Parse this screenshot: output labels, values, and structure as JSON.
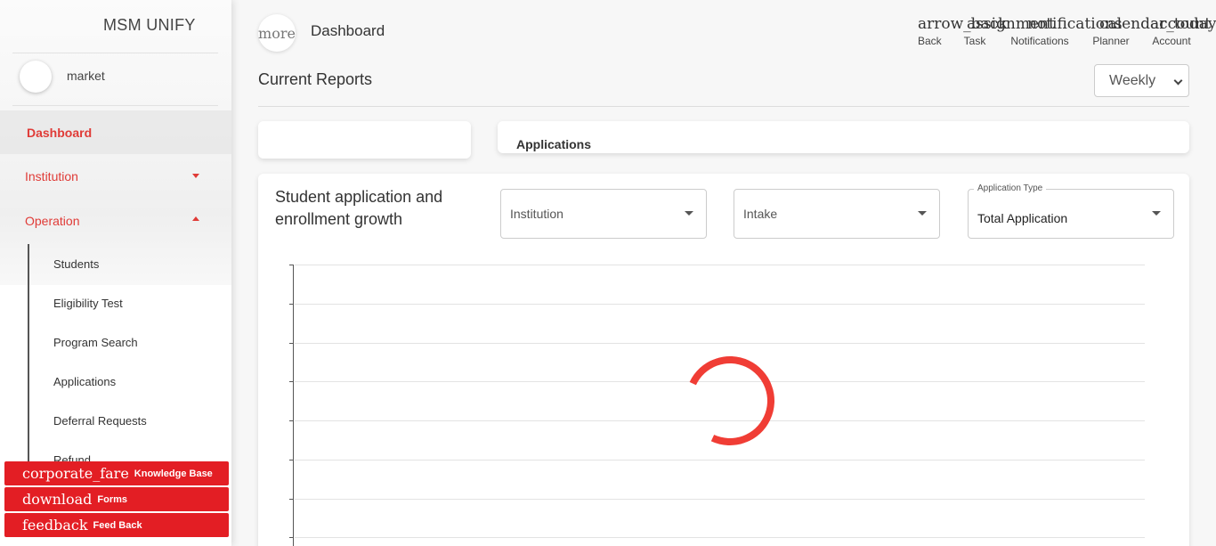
{
  "sidebar": {
    "brand": "MSM UNIFY",
    "user": {
      "name": "market"
    },
    "nav": {
      "dashboard": "Dashboard",
      "institution": "Institution",
      "operation": "Operation"
    },
    "operation_items": [
      "Students",
      "Eligibility Test",
      "Program Search",
      "Applications",
      "Deferral Requests",
      "Refund"
    ],
    "quick_links": [
      {
        "icon": "corporate_fare",
        "label": "Knowledge Base"
      },
      {
        "icon": "download",
        "label": "Forms"
      },
      {
        "icon": "feedback",
        "label": "Feed Back"
      }
    ]
  },
  "header": {
    "more_icon": "more",
    "title": "Dashboard",
    "actions": [
      {
        "icon": "arrow_back",
        "label": "Back"
      },
      {
        "icon": "assignment",
        "label": "Task"
      },
      {
        "icon": "notifications",
        "label": "Notifications"
      },
      {
        "icon": "calendar_today",
        "label": "Planner"
      },
      {
        "icon": "account",
        "label": "Account"
      }
    ]
  },
  "reports": {
    "title": "Current Reports",
    "period": "Weekly",
    "cards": {
      "left_title": "",
      "right_title": "Applications"
    }
  },
  "growth_chart": {
    "title": "Student application and enrollment growth",
    "filters": {
      "institution": {
        "placeholder": "Institution"
      },
      "intake": {
        "placeholder": "Intake"
      },
      "application_type": {
        "label": "Application Type",
        "value": "Total Application"
      }
    },
    "status": "loading",
    "colors": {
      "spinner": "#f03d35",
      "accent": "#e31e24"
    }
  }
}
